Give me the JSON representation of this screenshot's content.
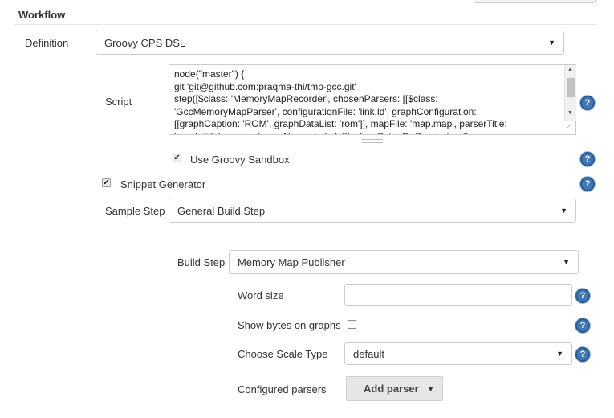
{
  "section": {
    "title": "Workflow"
  },
  "definition": {
    "label": "Definition",
    "value": "Groovy CPS DSL"
  },
  "script": {
    "label": "Script",
    "lines": [
      "node(\"master\") {",
      "git 'git@github.com:praqma-thi/tmp-gcc.git'",
      "step([$class: 'MemoryMapRecorder', chosenParsers: [[$class:",
      "'GccMemoryMapParser', configurationFile: 'link.ld', graphConfiguration:",
      "[[graphCaption: 'ROM', graphDataList: 'rom']], mapFile: 'map.map', parserTitle:",
      "'graph title', parserUniqueName: 'adsda']], showBytesOnGraph: true])"
    ]
  },
  "sandbox": {
    "label": "Use Groovy Sandbox",
    "checked": true
  },
  "snippet": {
    "label": "Snippet Generator",
    "checked": true
  },
  "sample_step": {
    "label": "Sample Step",
    "value": "General Build Step"
  },
  "build_step": {
    "label": "Build Step",
    "value": "Memory Map Publisher"
  },
  "word_size": {
    "label": "Word size",
    "value": ""
  },
  "show_bytes": {
    "label": "Show bytes on graphs",
    "checked": false
  },
  "scale_type": {
    "label": "Choose Scale Type",
    "value": "default"
  },
  "parsers": {
    "label": "Configured parsers",
    "button": "Add parser"
  },
  "glyphs": {
    "help": "?",
    "check": "✔",
    "arrow_down": "▼",
    "arrow_up": "▲"
  }
}
